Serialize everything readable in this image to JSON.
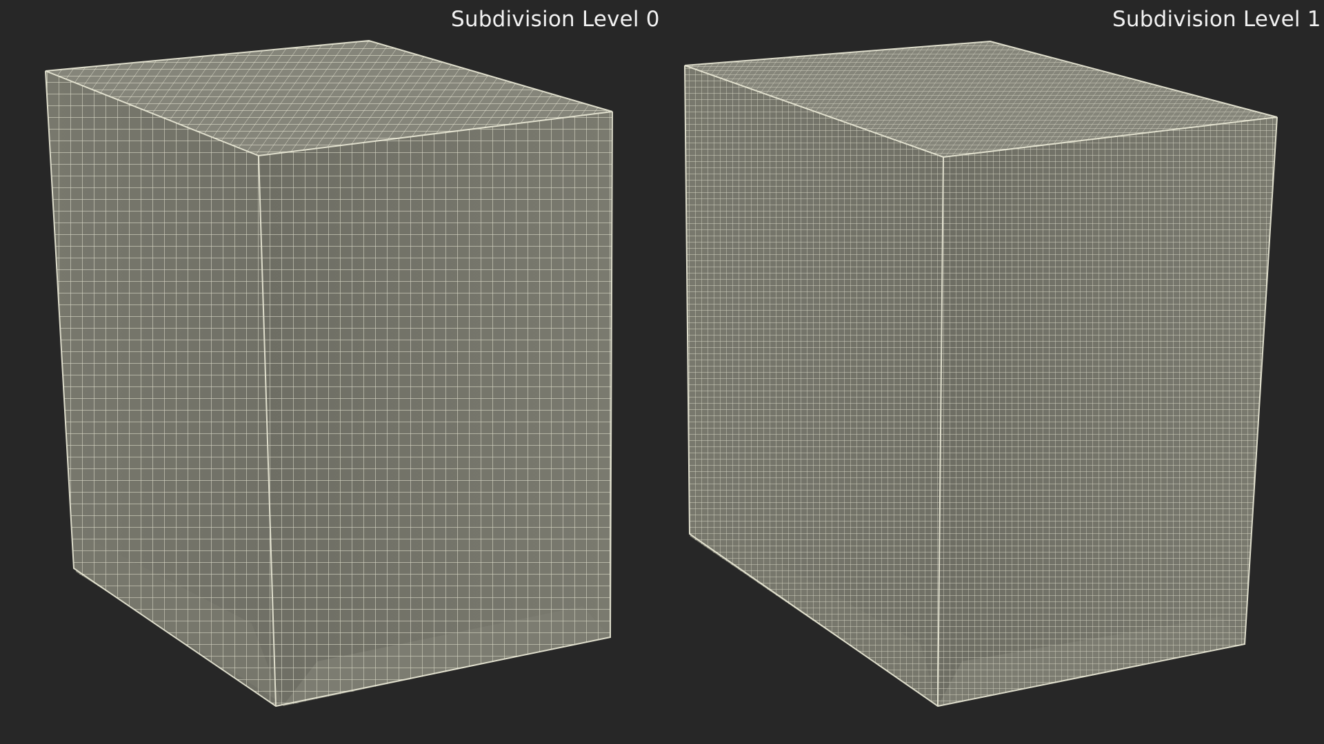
{
  "panels": [
    {
      "label": "Subdivision Level 0"
    },
    {
      "label": "Subdivision Level 1"
    }
  ],
  "colors": {
    "background": "#272727",
    "surface": "#7b7b70",
    "surface_dark": "#6f6f65",
    "surface_light": "#8a8a7f",
    "wire": "#ecebd8",
    "label": "#f2f2f2"
  }
}
